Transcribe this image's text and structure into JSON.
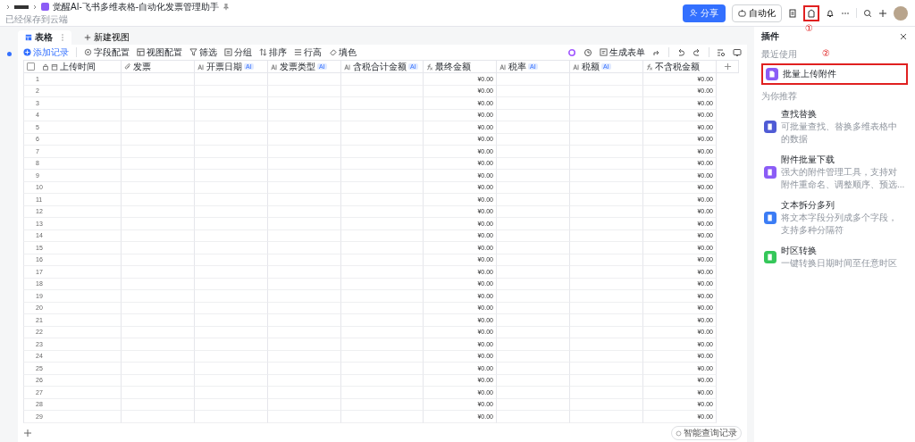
{
  "breadcrumb": {
    "title": "觉醒AI-飞书多维表格-自动化发票管理助手",
    "status": "已经保存到云端"
  },
  "header_actions": {
    "share": "分享",
    "automation": "自动化",
    "plugin_highlighted": true,
    "annotation": "①"
  },
  "tabs": [
    {
      "label": "表格",
      "selected": true
    }
  ],
  "new_view": "新建视图",
  "toolbar": [
    {
      "label": "添加记录",
      "kind": "add"
    },
    {
      "label": "字段配置",
      "kind": "fields"
    },
    {
      "label": "视图配置",
      "kind": "view"
    },
    {
      "label": "筛选",
      "kind": "filter"
    },
    {
      "label": "分组",
      "kind": "group"
    },
    {
      "label": "排序",
      "kind": "sort"
    },
    {
      "label": "行高",
      "kind": "height"
    },
    {
      "label": "填色",
      "kind": "color"
    }
  ],
  "generate_form": "生成表单",
  "table": {
    "select_all_checked": false,
    "columns": [
      {
        "name": "上传时间",
        "kind": "created"
      },
      {
        "name": "发票",
        "kind": "attachment"
      },
      {
        "name": "开票日期",
        "kind": "ai",
        "badge": "AI"
      },
      {
        "name": "发票类型",
        "kind": "ai",
        "badge": "AI"
      },
      {
        "name": "含税合计金额",
        "kind": "ai",
        "badge": "AI"
      },
      {
        "name": "最终金额",
        "kind": "formula"
      },
      {
        "name": "税率",
        "kind": "ai",
        "badge": "AI"
      },
      {
        "name": "税额",
        "kind": "ai",
        "badge": "AI"
      },
      {
        "name": "不含税金额",
        "kind": "formula"
      }
    ],
    "rows": [
      {
        "number": "1",
        "final": "¥0.00",
        "net": "¥0.00"
      },
      {
        "number": "2",
        "final": "¥0.00",
        "net": "¥0.00"
      },
      {
        "number": "3",
        "final": "¥0.00",
        "net": "¥0.00"
      },
      {
        "number": "4",
        "final": "¥0.00",
        "net": "¥0.00"
      },
      {
        "number": "5",
        "final": "¥0.00",
        "net": "¥0.00"
      },
      {
        "number": "6",
        "final": "¥0.00",
        "net": "¥0.00"
      },
      {
        "number": "7",
        "final": "¥0.00",
        "net": "¥0.00"
      },
      {
        "number": "8",
        "final": "¥0.00",
        "net": "¥0.00"
      },
      {
        "number": "9",
        "final": "¥0.00",
        "net": "¥0.00"
      },
      {
        "number": "10",
        "final": "¥0.00",
        "net": "¥0.00"
      },
      {
        "number": "11",
        "final": "¥0.00",
        "net": "¥0.00"
      },
      {
        "number": "12",
        "final": "¥0.00",
        "net": "¥0.00"
      },
      {
        "number": "13",
        "final": "¥0.00",
        "net": "¥0.00"
      },
      {
        "number": "14",
        "final": "¥0.00",
        "net": "¥0.00"
      },
      {
        "number": "15",
        "final": "¥0.00",
        "net": "¥0.00"
      },
      {
        "number": "16",
        "final": "¥0.00",
        "net": "¥0.00"
      },
      {
        "number": "17",
        "final": "¥0.00",
        "net": "¥0.00"
      },
      {
        "number": "18",
        "final": "¥0.00",
        "net": "¥0.00"
      },
      {
        "number": "19",
        "final": "¥0.00",
        "net": "¥0.00"
      },
      {
        "number": "20",
        "final": "¥0.00",
        "net": "¥0.00"
      },
      {
        "number": "21",
        "final": "¥0.00",
        "net": "¥0.00"
      },
      {
        "number": "22",
        "final": "¥0.00",
        "net": "¥0.00"
      },
      {
        "number": "23",
        "final": "¥0.00",
        "net": "¥0.00"
      },
      {
        "number": "24",
        "final": "¥0.00",
        "net": "¥0.00"
      },
      {
        "number": "25",
        "final": "¥0.00",
        "net": "¥0.00"
      },
      {
        "number": "26",
        "final": "¥0.00",
        "net": "¥0.00"
      },
      {
        "number": "27",
        "final": "¥0.00",
        "net": "¥0.00"
      },
      {
        "number": "28",
        "final": "¥0.00",
        "net": "¥0.00"
      },
      {
        "number": "29",
        "final": "¥0.00",
        "net": "¥0.00"
      }
    ]
  },
  "smart_query": "智能查询记录",
  "plugin_panel": {
    "title": "插件",
    "recent_heading": "最近使用",
    "recent_annotation": "②",
    "recent": [
      {
        "name": "批量上传附件",
        "color": "#8b5cf6",
        "highlighted": true
      }
    ],
    "recommended_heading": "为你推荐",
    "recommended": [
      {
        "name": "查找替换",
        "description": "可批量查找、替换多维表格中的数据",
        "color": "#4f5bd5"
      },
      {
        "name": "附件批量下载",
        "description": "强大的附件管理工具，支持对附件重命名、调整顺序、预选...",
        "color": "#8b5cf6"
      },
      {
        "name": "文本拆分多列",
        "description": "将文本字段分列成多个字段，支持多种分隔符",
        "color": "#3b7cf5"
      },
      {
        "name": "时区转换",
        "description": "一键转换日期时间至任意时区",
        "color": "#34c759"
      }
    ]
  }
}
